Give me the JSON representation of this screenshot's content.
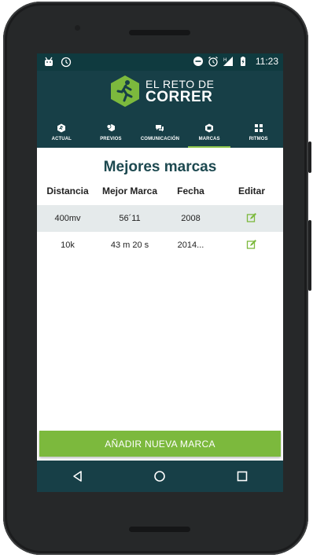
{
  "status_bar": {
    "time": "11:23",
    "left_icons": [
      "android-icon",
      "clock-icon"
    ],
    "right_icons": [
      "do-not-disturb-icon",
      "alarm-icon",
      "signal-icon",
      "battery-icon"
    ]
  },
  "header": {
    "logo_line1": "EL RETO DE",
    "logo_line2": "CORRER",
    "colors": {
      "bar": "#173f47",
      "status": "#0f3a3f",
      "logo_green": "#7cb93d"
    }
  },
  "tabs": [
    {
      "label": "ACTUAL",
      "icon": "runner-icon",
      "active": false
    },
    {
      "label": "PREVIOS",
      "icon": "history-icon",
      "active": false
    },
    {
      "label": "COMUNICACIÓN",
      "icon": "chat-icon",
      "active": false
    },
    {
      "label": "MARCAS",
      "icon": "medal-icon",
      "active": true
    },
    {
      "label": "RITMOS",
      "icon": "grid-icon",
      "active": false
    }
  ],
  "main": {
    "title": "Mejores marcas",
    "columns": [
      "Distancia",
      "Mejor Marca",
      "Fecha",
      "Editar"
    ],
    "rows": [
      {
        "distance": "400mv",
        "best": "56´11",
        "date": "2008"
      },
      {
        "distance": "10k",
        "best": "43 m 20 s",
        "date": "2014..."
      }
    ]
  },
  "add_button": {
    "label": "AÑADIR NUEVA MARCA",
    "color": "#7cb93d"
  },
  "navbar": {
    "buttons": [
      "back-icon",
      "home-icon",
      "recents-icon"
    ]
  }
}
